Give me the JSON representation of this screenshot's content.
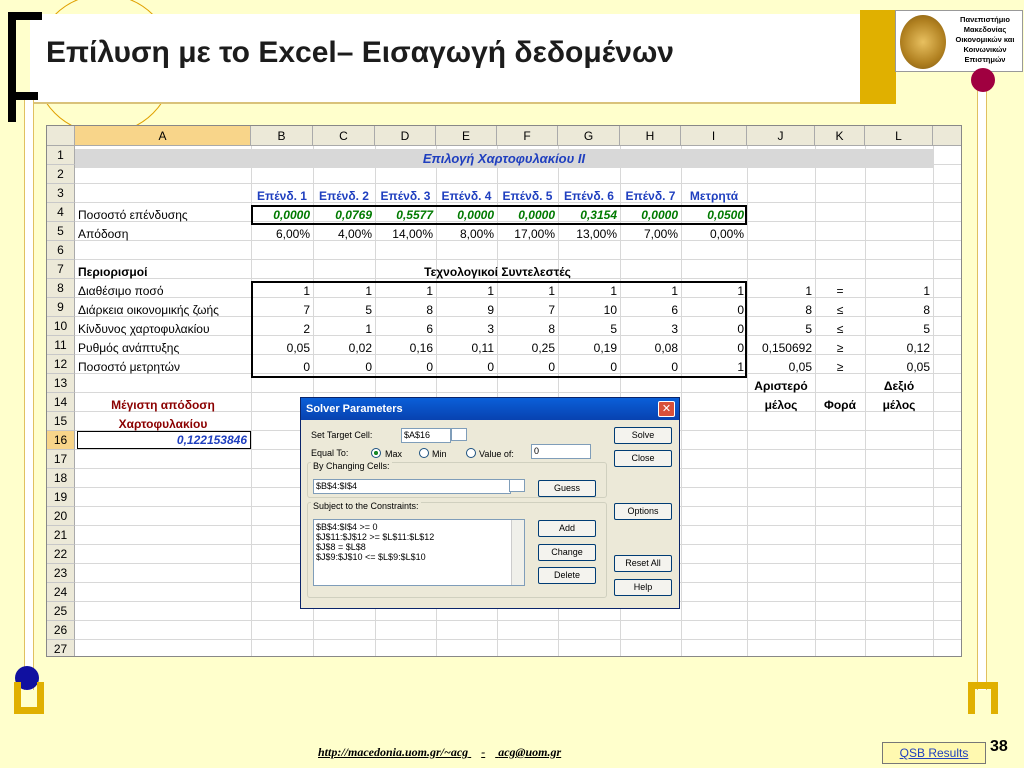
{
  "slide": {
    "title": "Επίλυση με το Excel– Εισαγωγή δεδομένων",
    "logo_text": [
      "Πανεπιστήμιο",
      "Μακεδονίας",
      "Οικονομικών και",
      "Κοινωνικών Επιστημών"
    ],
    "footer_link1": "http://macedonia.uom.gr/~acg",
    "footer_sep": "-",
    "footer_link2": "acg@uom.gr",
    "qsb_button": "QSB Results",
    "page_number": "38",
    "colors": {
      "background": "#ffffcc",
      "gold": "#e0b000",
      "dot_red": "#a00040",
      "dot_blue": "#1010a0"
    }
  },
  "sheet": {
    "columns": [
      "A",
      "B",
      "C",
      "D",
      "E",
      "F",
      "G",
      "H",
      "I",
      "J",
      "K",
      "L"
    ],
    "rows": [
      "1",
      "2",
      "3",
      "4",
      "5",
      "6",
      "7",
      "8",
      "9",
      "10",
      "11",
      "12",
      "13",
      "14",
      "15",
      "16",
      "17",
      "18",
      "19",
      "20",
      "21",
      "22",
      "23",
      "24",
      "25",
      "26",
      "27"
    ],
    "r1_title": "Επιλογή  Χαρτοφυλακίου  ΙΙ",
    "r3_headers": [
      "Επένδ. 1",
      "Επένδ. 2",
      "Επένδ. 3",
      "Επένδ. 4",
      "Επένδ. 5",
      "Επένδ. 6",
      "Επένδ. 7",
      "Μετρητά"
    ],
    "r4_label": "Ποσοστό επένδυσης",
    "r4_values": [
      "0,0000",
      "0,0769",
      "0,5577",
      "0,0000",
      "0,0000",
      "0,3154",
      "0,0000",
      "0,0500"
    ],
    "r5_label": "Απόδοση",
    "r5_values": [
      "6,00%",
      "4,00%",
      "14,00%",
      "8,00%",
      "17,00%",
      "13,00%",
      "7,00%",
      "0,00%"
    ],
    "r7_label": "Περιορισμοί",
    "r7_center": "Τεχνολογικοί  Συντελεστές",
    "constraints": [
      {
        "label": "Διαθέσιμο ποσό",
        "values": [
          "1",
          "1",
          "1",
          "1",
          "1",
          "1",
          "1",
          "1"
        ],
        "lhs": "1",
        "sign": "=",
        "rhs": "1"
      },
      {
        "label": "Διάρκεια οικονομικής ζωής",
        "values": [
          "7",
          "5",
          "8",
          "9",
          "7",
          "10",
          "6",
          "0"
        ],
        "lhs": "8",
        "sign": "≤",
        "rhs": "8"
      },
      {
        "label": "Κίνδυνος χαρτοφυλακίου",
        "values": [
          "2",
          "1",
          "6",
          "3",
          "8",
          "5",
          "3",
          "0"
        ],
        "lhs": "5",
        "sign": "≤",
        "rhs": "5"
      },
      {
        "label": "Ρυθμός ανάπτυξης",
        "values": [
          "0,05",
          "0,02",
          "0,16",
          "0,11",
          "0,25",
          "0,19",
          "0,08",
          "0"
        ],
        "lhs": "0,150692",
        "sign": "≥",
        "rhs": "0,12"
      },
      {
        "label": "Ποσοστό μετρητών",
        "values": [
          "0",
          "0",
          "0",
          "0",
          "0",
          "0",
          "0",
          "1"
        ],
        "lhs": "0,05",
        "sign": "≥",
        "rhs": "0,05"
      }
    ],
    "r13_j": "Αριστερό",
    "r13_l": "Δεξιό",
    "r14_a": "Μέγιστη απόδοση",
    "r14_j": "μέλος",
    "r14_k": "Φορά",
    "r14_l": "μέλος",
    "r15_a": "Χαρτοφυλακίου",
    "r16_a": "0,122153846"
  },
  "solver": {
    "title": "Solver Parameters",
    "set_target_label": "Set Target Cell:",
    "target_value": "$A$16",
    "equal_to_label": "Equal To:",
    "max_label": "Max",
    "min_label": "Min",
    "value_of_label": "Value of:",
    "value_of_value": "0",
    "changing_label": "By Changing Cells:",
    "changing_value": "$B$4:$I$4",
    "constraints_label": "Subject to the Constraints:",
    "constraints": [
      "$B$4:$I$4 >= 0",
      "$J$11:$J$12 >= $L$11:$L$12",
      "$J$8 = $L$8",
      "$J$9:$J$10 <= $L$9:$L$10"
    ],
    "buttons": {
      "solve": "Solve",
      "close": "Close",
      "guess": "Guess",
      "options": "Options",
      "add": "Add",
      "change": "Change",
      "delete": "Delete",
      "reset": "Reset All",
      "help": "Help"
    }
  }
}
